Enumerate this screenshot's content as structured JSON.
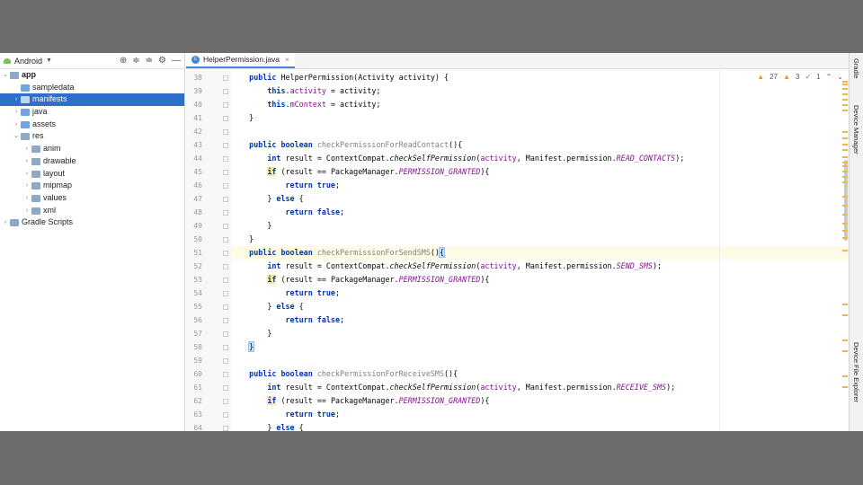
{
  "project_panel": {
    "view_selector": "Android",
    "tree": [
      {
        "label": "app",
        "depth": 0,
        "expanded": true,
        "bold": true
      },
      {
        "label": "sampledata",
        "depth": 1,
        "expanded": null
      },
      {
        "label": "manifests",
        "depth": 1,
        "expanded": false,
        "selected": true
      },
      {
        "label": "java",
        "depth": 1,
        "expanded": false
      },
      {
        "label": "assets",
        "depth": 1,
        "expanded": false
      },
      {
        "label": "res",
        "depth": 1,
        "expanded": true
      },
      {
        "label": "anim",
        "depth": 2,
        "expanded": false
      },
      {
        "label": "drawable",
        "depth": 2,
        "expanded": false
      },
      {
        "label": "layout",
        "depth": 2,
        "expanded": false
      },
      {
        "label": "mipmap",
        "depth": 2,
        "expanded": false
      },
      {
        "label": "values",
        "depth": 2,
        "expanded": false
      },
      {
        "label": "xml",
        "depth": 2,
        "expanded": false
      },
      {
        "label": "Gradle Scripts",
        "depth": 0,
        "expanded": false
      }
    ]
  },
  "editor": {
    "tab": {
      "label": "HelperPermission.java",
      "icon": "c-class-icon"
    },
    "inspections": {
      "warnings": "27",
      "weak_warnings": "3",
      "ok": "1"
    },
    "current_line": "51",
    "lines": [
      {
        "n": "38",
        "html": "    <span class=\"kw\">public</span> HelperPermission(Activity activity) {"
      },
      {
        "n": "39",
        "html": "        <span class=\"kw\">this</span>.<span class=\"fld\">activity</span> = activity;"
      },
      {
        "n": "40",
        "html": "        <span class=\"kw\">this</span>.<span class=\"fld\">mContext</span> = activity;"
      },
      {
        "n": "41",
        "html": "    }"
      },
      {
        "n": "42",
        "html": ""
      },
      {
        "n": "43",
        "html": "    <span class=\"kw\">public boolean</span> <span class=\"fn\">checkPermissionForReadContact</span>(){"
      },
      {
        "n": "44",
        "html": "        <span class=\"kw\">int</span> result = ContextCompat.<span class=\"it\">checkSelfPermission</span>(<span class=\"fld\">activity</span>, Manifest.permission.<span class=\"itf\">READ_CONTACTS</span>);"
      },
      {
        "n": "45",
        "html": "        <span class=\"kw hl\">if</span> (result == PackageManager.<span class=\"itf\">PERMISSION_GRANTED</span>){"
      },
      {
        "n": "46",
        "html": "            <span class=\"kw\">return true</span>;"
      },
      {
        "n": "47",
        "html": "        } <span class=\"kw\">else</span> {"
      },
      {
        "n": "48",
        "html": "            <span class=\"kw\">return false</span>;"
      },
      {
        "n": "49",
        "html": "        }"
      },
      {
        "n": "50",
        "html": "    }"
      },
      {
        "n": "51",
        "html": "    <span class=\"kw\">public boolean</span> <span class=\"fn\">checkPermissionForSendSMS</span>()<span class=\"br\">{</span>"
      },
      {
        "n": "52",
        "html": "        <span class=\"kw\">int</span> result = ContextCompat.<span class=\"it\">checkSelfPermission</span>(<span class=\"fld\">activity</span>, Manifest.permission.<span class=\"itf\">SEND_SMS</span>);"
      },
      {
        "n": "53",
        "html": "        <span class=\"kw hl\">if</span> (result == PackageManager.<span class=\"itf\">PERMISSION_GRANTED</span>){"
      },
      {
        "n": "54",
        "html": "            <span class=\"kw\">return true</span>;"
      },
      {
        "n": "55",
        "html": "        } <span class=\"kw\">else</span> {"
      },
      {
        "n": "56",
        "html": "            <span class=\"kw\">return false</span>;"
      },
      {
        "n": "57",
        "html": "        }"
      },
      {
        "n": "58",
        "html": "    <span class=\"br\">}</span>"
      },
      {
        "n": "59",
        "html": ""
      },
      {
        "n": "60",
        "html": "    <span class=\"kw\">public boolean</span> <span class=\"fn\">checkPermissionForReceiveSMS</span>(){"
      },
      {
        "n": "61",
        "html": "        <span class=\"kw\">int</span> result = ContextCompat.<span class=\"it\">checkSelfPermission</span>(<span class=\"fld\">activity</span>, Manifest.permission.<span class=\"itf\">RECEIVE_SMS</span>);"
      },
      {
        "n": "62",
        "html": "        <span class=\"kw hl\">if</span> (result == PackageManager.<span class=\"itf\">PERMISSION_GRANTED</span>){"
      },
      {
        "n": "63",
        "html": "            <span class=\"kw\">return true</span>;"
      },
      {
        "n": "64",
        "html": "        } <span class=\"kw\">else</span> {"
      }
    ]
  },
  "right_tools": {
    "gradle": "Gradle",
    "device_manager": "Device Manager",
    "device_file_explorer": "Device File Explorer"
  },
  "colors": {
    "selection": "#2f6fcc",
    "keyword": "#0033b3",
    "field": "#871094",
    "warning": "#e5a100"
  }
}
